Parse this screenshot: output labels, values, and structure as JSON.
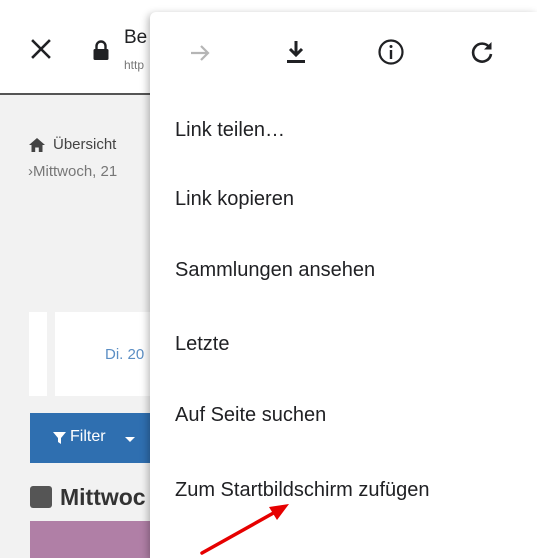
{
  "toolbar": {
    "title": "Be",
    "url": "http"
  },
  "page": {
    "breadcrumb_home": "Übersicht",
    "breadcrumb_sub": "›Mittwoch, 21",
    "date_label": "Di. 20",
    "filter_label": "Filter",
    "section_title": "Mittwoc"
  },
  "menu": {
    "icons": [
      "forward-icon",
      "download-icon",
      "info-icon",
      "reload-icon"
    ],
    "items": [
      "Link teilen…",
      "Link kopieren",
      "Sammlungen ansehen",
      "Letzte",
      "Auf Seite suchen",
      "Zum Startbildschirm zufügen"
    ]
  },
  "colors": {
    "filter_button": "#2f6fb0",
    "date_text": "#5b8ec4",
    "annotation_arrow": "#e60000",
    "pink_bar": "#b07fa6"
  }
}
